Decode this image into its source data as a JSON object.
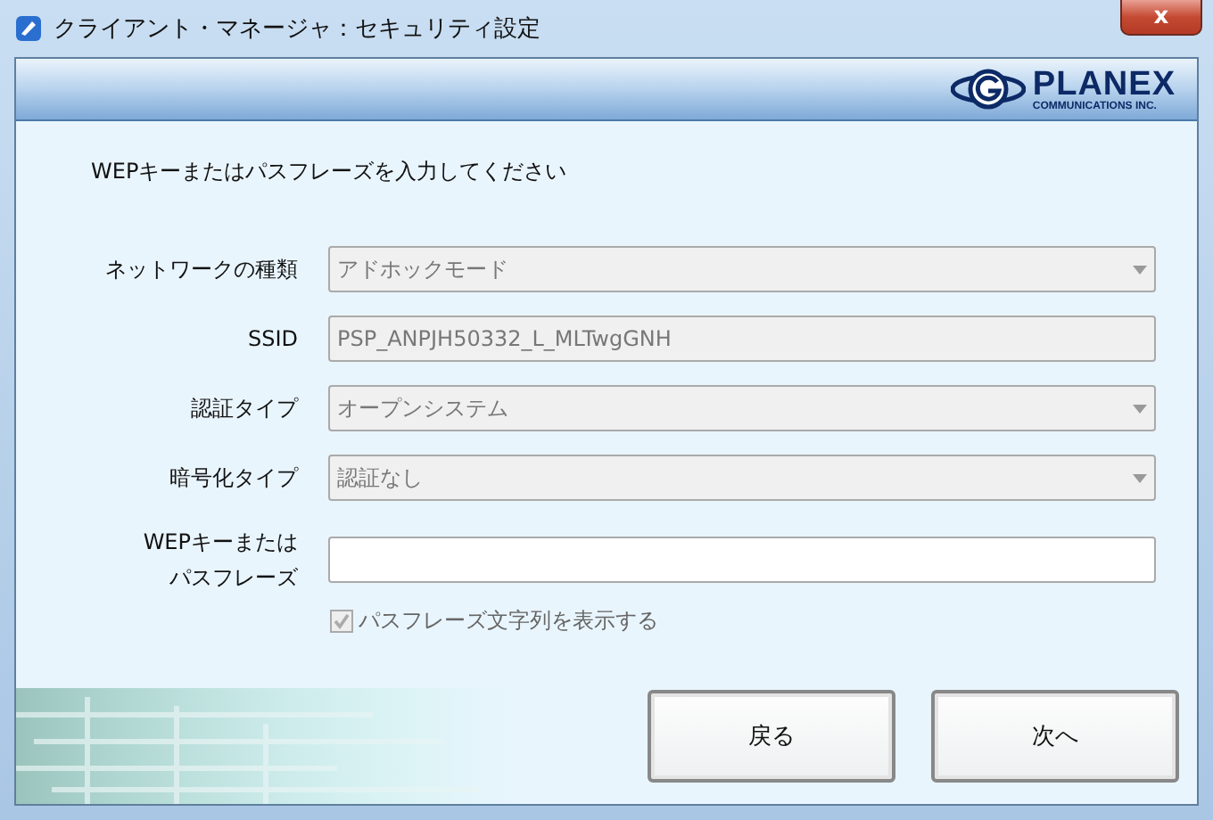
{
  "window": {
    "title": "クライアント・マネージャ：セキュリティ設定",
    "close": "x"
  },
  "logo": {
    "name": "PLANEX",
    "subtitle": "COMMUNICATIONS INC."
  },
  "instruction": "WEPキーまたはパスフレーズを入力してください",
  "fields": [
    {
      "label": "ネットワークの種類",
      "kind": "select",
      "value": "アドホックモード",
      "disabled": true
    },
    {
      "label": "SSID",
      "kind": "text",
      "value": "PSP_ANPJH50332_L_MLTwgGNH",
      "disabled": true
    },
    {
      "label": "認証タイプ",
      "kind": "select",
      "value": "オープンシステム",
      "disabled": true
    },
    {
      "label": "暗号化タイプ",
      "kind": "select",
      "value": "認証なし",
      "disabled": true
    },
    {
      "label": [
        "WEPキーまたは",
        "パスフレーズ"
      ],
      "kind": "text",
      "disabled": false
    }
  ],
  "show_passphrase": {
    "label": "パスフレーズ文字列を表示する",
    "checked": true,
    "disabled": true
  },
  "buttons": [
    {
      "label": "戻る"
    },
    {
      "label": "次へ"
    }
  ]
}
